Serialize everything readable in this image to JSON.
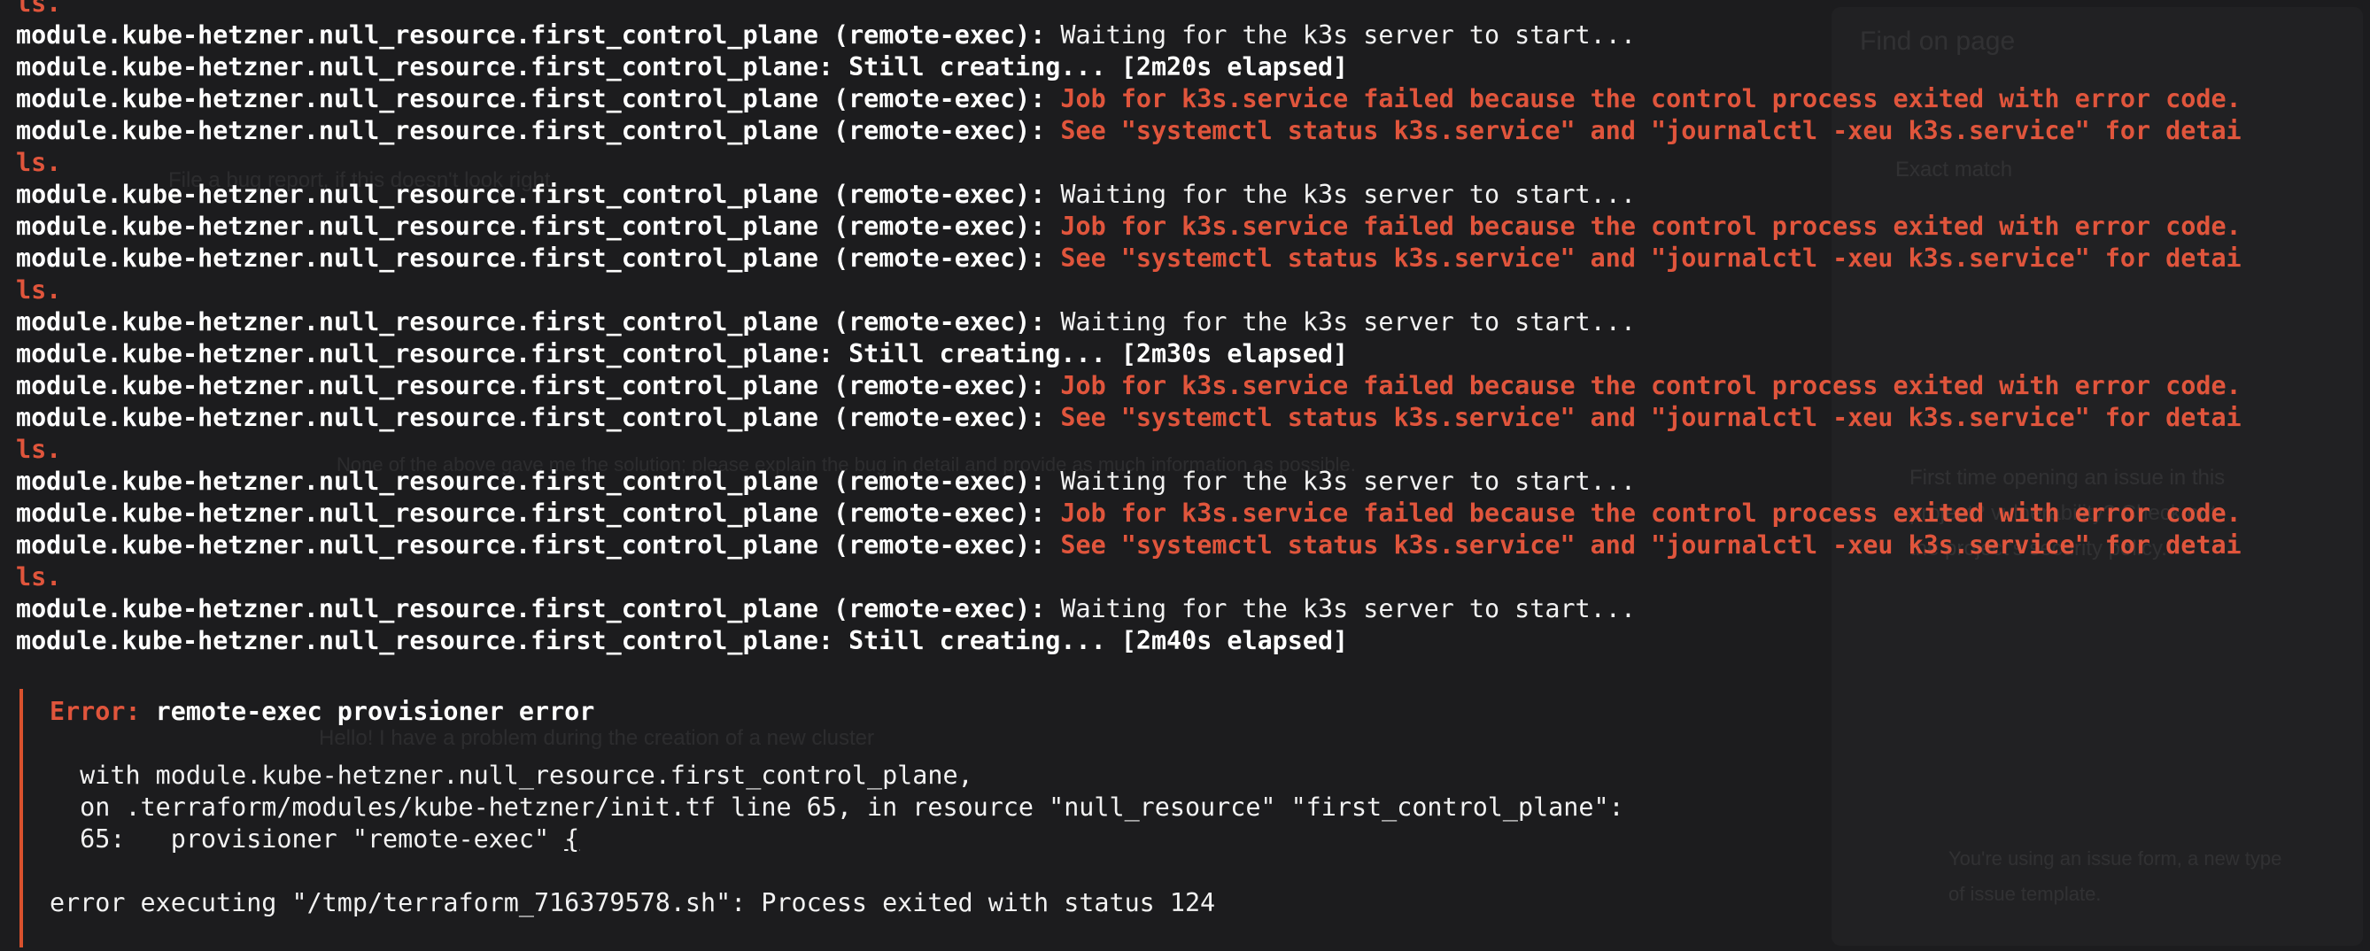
{
  "terminal": {
    "lines": [
      {
        "kind": "wrap",
        "text": "ls."
      },
      {
        "kind": "info",
        "prefix": "module.kube-hetzner.null_resource.first_control_plane (remote-exec):",
        "message": " Waiting for the k3s server to start..."
      },
      {
        "kind": "status",
        "text": "module.kube-hetzner.null_resource.first_control_plane: Still creating... [2m20s elapsed]"
      },
      {
        "kind": "error",
        "prefix": "module.kube-hetzner.null_resource.first_control_plane (remote-exec):",
        "message": " Job for k3s.service failed because the control process exited with error code."
      },
      {
        "kind": "error",
        "prefix": "module.kube-hetzner.null_resource.first_control_plane (remote-exec):",
        "message": " See \"systemctl status k3s.service\" and \"journalctl -xeu k3s.service\" for detai"
      },
      {
        "kind": "wrap",
        "text": "ls."
      },
      {
        "kind": "info",
        "prefix": "module.kube-hetzner.null_resource.first_control_plane (remote-exec):",
        "message": " Waiting for the k3s server to start..."
      },
      {
        "kind": "error",
        "prefix": "module.kube-hetzner.null_resource.first_control_plane (remote-exec):",
        "message": " Job for k3s.service failed because the control process exited with error code."
      },
      {
        "kind": "error",
        "prefix": "module.kube-hetzner.null_resource.first_control_plane (remote-exec):",
        "message": " See \"systemctl status k3s.service\" and \"journalctl -xeu k3s.service\" for detai"
      },
      {
        "kind": "wrap",
        "text": "ls."
      },
      {
        "kind": "info",
        "prefix": "module.kube-hetzner.null_resource.first_control_plane (remote-exec):",
        "message": " Waiting for the k3s server to start..."
      },
      {
        "kind": "status",
        "text": "module.kube-hetzner.null_resource.first_control_plane: Still creating... [2m30s elapsed]"
      },
      {
        "kind": "error",
        "prefix": "module.kube-hetzner.null_resource.first_control_plane (remote-exec):",
        "message": " Job for k3s.service failed because the control process exited with error code."
      },
      {
        "kind": "error",
        "prefix": "module.kube-hetzner.null_resource.first_control_plane (remote-exec):",
        "message": " See \"systemctl status k3s.service\" and \"journalctl -xeu k3s.service\" for detai"
      },
      {
        "kind": "wrap",
        "text": "ls."
      },
      {
        "kind": "info",
        "prefix": "module.kube-hetzner.null_resource.first_control_plane (remote-exec):",
        "message": " Waiting for the k3s server to start..."
      },
      {
        "kind": "error",
        "prefix": "module.kube-hetzner.null_resource.first_control_plane (remote-exec):",
        "message": " Job for k3s.service failed because the control process exited with error code."
      },
      {
        "kind": "error",
        "prefix": "module.kube-hetzner.null_resource.first_control_plane (remote-exec):",
        "message": " See \"systemctl status k3s.service\" and \"journalctl -xeu k3s.service\" for detai"
      },
      {
        "kind": "wrap",
        "text": "ls."
      },
      {
        "kind": "info",
        "prefix": "module.kube-hetzner.null_resource.first_control_plane (remote-exec):",
        "message": " Waiting for the k3s server to start..."
      },
      {
        "kind": "status",
        "text": "module.kube-hetzner.null_resource.first_control_plane: Still creating... [2m40s elapsed]"
      }
    ],
    "error_block": {
      "label": "Error:",
      "summary": " remote-exec provisioner error",
      "with_line": "  with module.kube-hetzner.null_resource.first_control_plane,",
      "on_line": "  on .terraform/modules/kube-hetzner/init.tf line 65, in resource \"null_resource\" \"first_control_plane\":",
      "code_prefix": "  65:   provisioner \"remote-exec\" ",
      "code_brace": "{",
      "detail": "error executing \"/tmp/terraform_716379578.sh\": Process exited with status 124"
    }
  },
  "background": {
    "find_title": "Find on page",
    "exact_match": "Exact match",
    "bug_text": "File a bug report, if this doesn't look right.",
    "issue_text": "Hello! I have a problem during the creation of a new cluster",
    "body_text": "None of the above gave me the solution; please explain the bug in detail and provide as much information as possible.",
    "side_text": "First time opening an issue in this project? vulnerability? Check out the project's security policy.",
    "side_text_2": "You're using an issue form, a new type of issue template."
  },
  "colors": {
    "background": "#1c1c1e",
    "error_red": "#e0553c",
    "error_border": "#d9512d",
    "text": "#ffffff"
  }
}
